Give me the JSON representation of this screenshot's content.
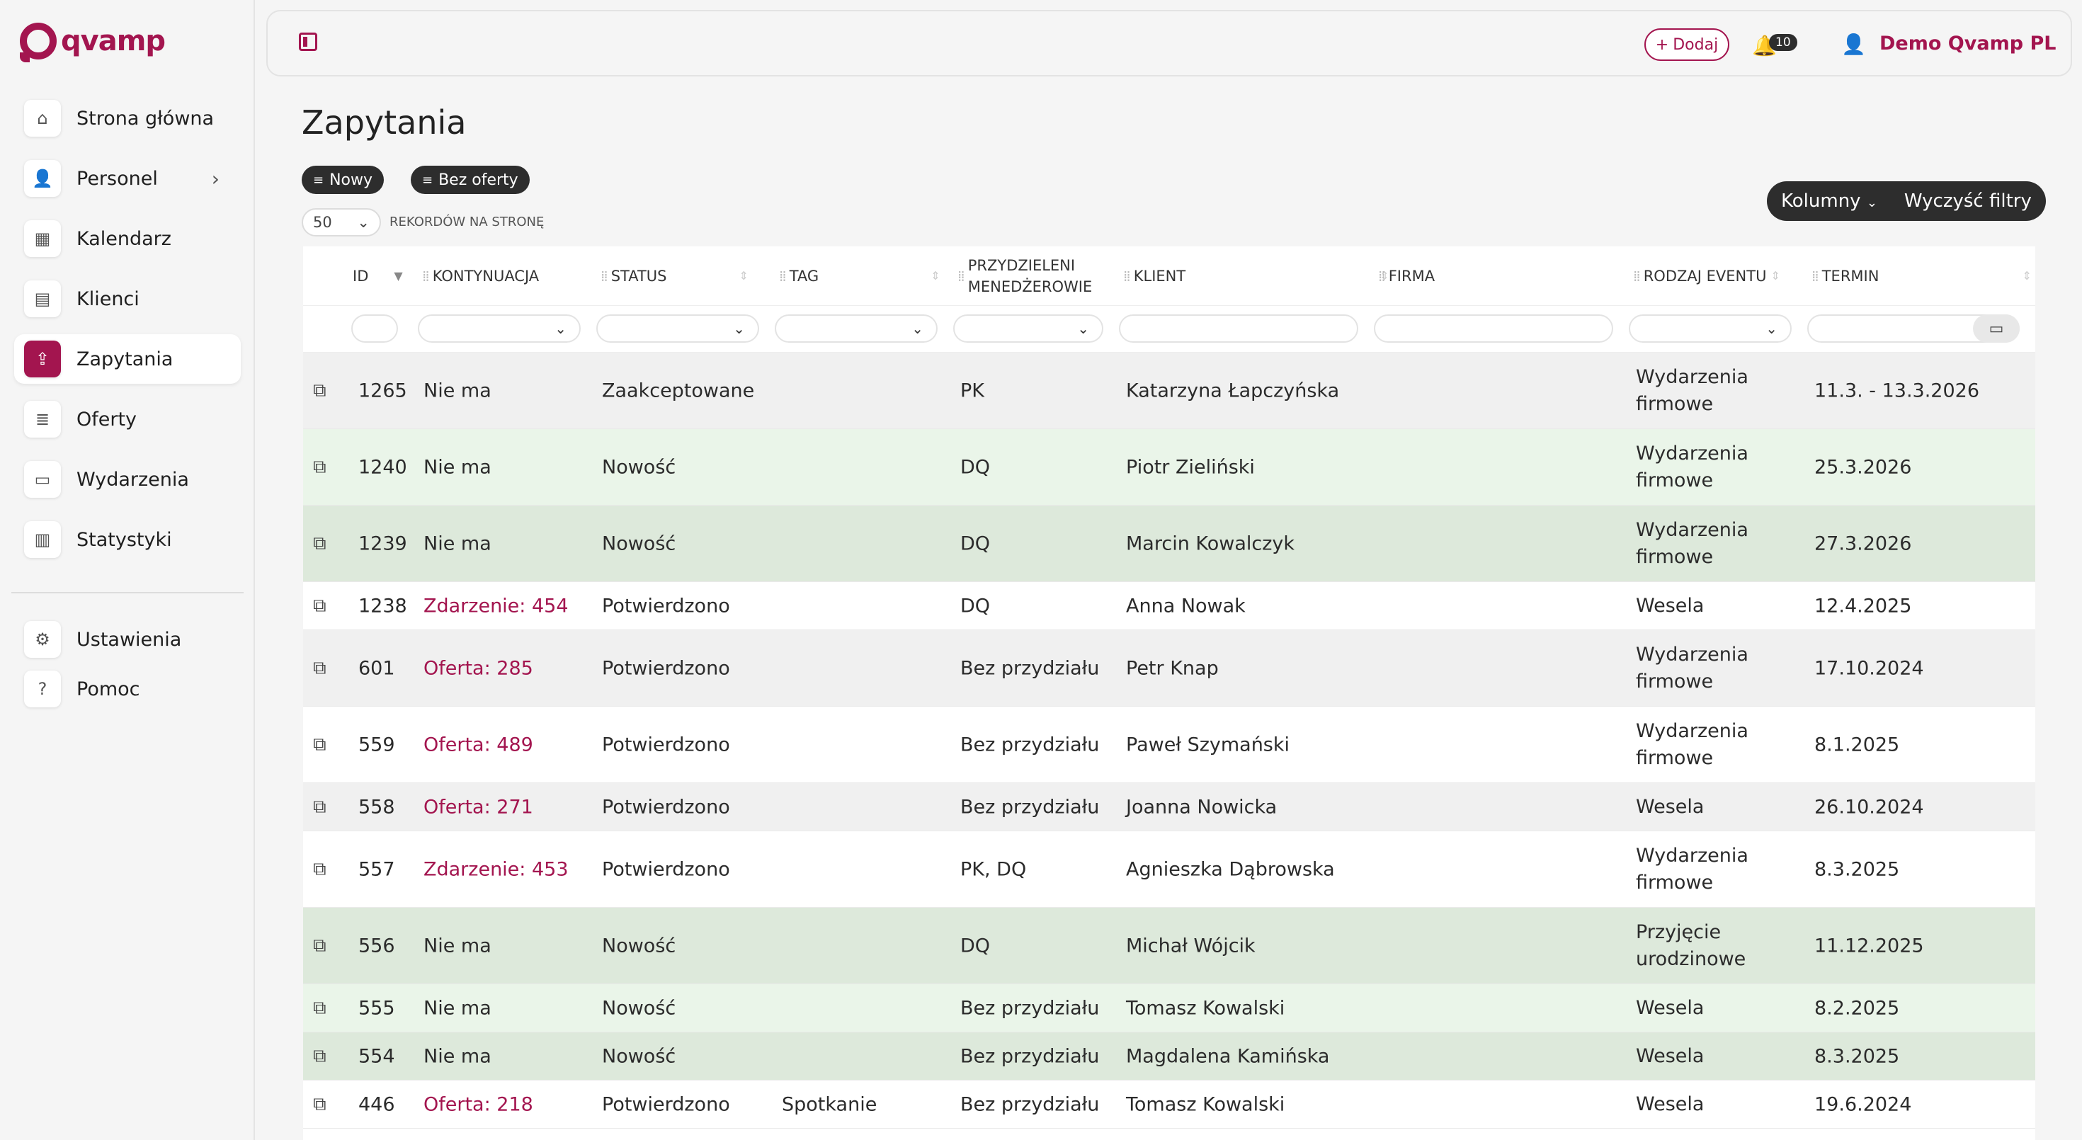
{
  "brand": {
    "name": "qvamp",
    "color": "#a3154f"
  },
  "sidebar": {
    "items": [
      {
        "label": "Strona główna",
        "icon": "home-icon"
      },
      {
        "label": "Personel",
        "icon": "person-icon",
        "expandable": true
      },
      {
        "label": "Kalendarz",
        "icon": "calendar-icon"
      },
      {
        "label": "Klienci",
        "icon": "id-card-icon"
      },
      {
        "label": "Zapytania",
        "icon": "inquiry-icon",
        "active": true
      },
      {
        "label": "Oferty",
        "icon": "document-icon"
      },
      {
        "label": "Wydarzenia",
        "icon": "event-icon"
      },
      {
        "label": "Statystyki",
        "icon": "stats-icon"
      }
    ],
    "bottom_items": [
      {
        "label": "Ustawienia",
        "icon": "gear-icon"
      },
      {
        "label": "Pomoc",
        "icon": "help-icon"
      }
    ]
  },
  "header": {
    "add_label": "Dodaj",
    "notifications_count": "10",
    "user_name": "Demo Qvamp PL"
  },
  "page": {
    "title": "Zapytania",
    "active_filters": [
      "Nowy",
      "Bez oferty"
    ],
    "per_page_value": "50",
    "per_page_label": "REKORDÓW NA STRONĘ",
    "columns_button": "Kolumny",
    "clear_filters_button": "Wyczyść filtry"
  },
  "table": {
    "columns": [
      "ID",
      "KONTYNUACJA",
      "STATUS",
      "TAG",
      "PRZYDZIELENI MENEDŻEROWIE",
      "KLIENT",
      "FIRMA",
      "RODZAJ EVENTU",
      "TERMIN"
    ],
    "rows": [
      {
        "id": "1265",
        "kontynuacja": "Nie ma",
        "link": false,
        "status": "Zaakceptowane",
        "tag": "",
        "managers": "PK",
        "client": "Katarzyna Łapczyńska",
        "firma": "",
        "event": "Wydarzenia firmowe",
        "termin": "11.3. - 13.3.2026",
        "bg": "#f0f0f0"
      },
      {
        "id": "1240",
        "kontynuacja": "Nie ma",
        "link": false,
        "status": "Nowość",
        "tag": "",
        "managers": "DQ",
        "client": "Piotr Zieliński",
        "firma": "",
        "event": "Wydarzenia firmowe",
        "termin": "25.3.2026",
        "bg": "#eaf5e9"
      },
      {
        "id": "1239",
        "kontynuacja": "Nie ma",
        "link": false,
        "status": "Nowość",
        "tag": "",
        "managers": "DQ",
        "client": "Marcin Kowalczyk",
        "firma": "",
        "event": "Wydarzenia firmowe",
        "termin": "27.3.2026",
        "bg": "#dde9db"
      },
      {
        "id": "1238",
        "kontynuacja": "Zdarzenie: 454",
        "link": true,
        "status": "Potwierdzono",
        "tag": "",
        "managers": "DQ",
        "client": "Anna Nowak",
        "firma": "",
        "event": "Wesela",
        "termin": "12.4.2025",
        "bg": "#ffffff"
      },
      {
        "id": "601",
        "kontynuacja": "Oferta: 285",
        "link": true,
        "status": "Potwierdzono",
        "tag": "",
        "managers": "Bez przydziału",
        "client": "Petr Knap",
        "firma": "",
        "event": "Wydarzenia firmowe",
        "termin": "17.10.2024",
        "bg": "#f0f0f0"
      },
      {
        "id": "559",
        "kontynuacja": "Oferta: 489",
        "link": true,
        "status": "Potwierdzono",
        "tag": "",
        "managers": "Bez przydziału",
        "client": "Paweł Szymański",
        "firma": "",
        "event": "Wydarzenia firmowe",
        "termin": "8.1.2025",
        "bg": "#ffffff"
      },
      {
        "id": "558",
        "kontynuacja": "Oferta: 271",
        "link": true,
        "status": "Potwierdzono",
        "tag": "",
        "managers": "Bez przydziału",
        "client": "Joanna Nowicka",
        "firma": "",
        "event": "Wesela",
        "termin": "26.10.2024",
        "bg": "#f0f0f0"
      },
      {
        "id": "557",
        "kontynuacja": "Zdarzenie: 453",
        "link": true,
        "status": "Potwierdzono",
        "tag": "",
        "managers": "PK, DQ",
        "client": "Agnieszka Dąbrowska",
        "firma": "",
        "event": "Wydarzenia firmowe",
        "termin": "8.3.2025",
        "bg": "#ffffff"
      },
      {
        "id": "556",
        "kontynuacja": "Nie ma",
        "link": false,
        "status": "Nowość",
        "tag": "",
        "managers": "DQ",
        "client": "Michał Wójcik",
        "firma": "",
        "event": "Przyjęcie urodzinowe",
        "termin": "11.12.2025",
        "bg": "#dde9db"
      },
      {
        "id": "555",
        "kontynuacja": "Nie ma",
        "link": false,
        "status": "Nowość",
        "tag": "",
        "managers": "Bez przydziału",
        "client": "Tomasz Kowalski",
        "firma": "",
        "event": "Wesela",
        "termin": "8.2.2025",
        "bg": "#eaf5e9"
      },
      {
        "id": "554",
        "kontynuacja": "Nie ma",
        "link": false,
        "status": "Nowość",
        "tag": "",
        "managers": "Bez przydziału",
        "client": "Magdalena Kamińska",
        "firma": "",
        "event": "Wesela",
        "termin": "8.3.2025",
        "bg": "#dde9db"
      },
      {
        "id": "446",
        "kontynuacja": "Oferta: 218",
        "link": true,
        "status": "Potwierdzono",
        "tag": "Spotkanie",
        "managers": "Bez przydziału",
        "client": "Tomasz Kowalski",
        "firma": "",
        "event": "Wesela",
        "termin": "19.6.2024",
        "bg": "#ffffff"
      }
    ]
  }
}
